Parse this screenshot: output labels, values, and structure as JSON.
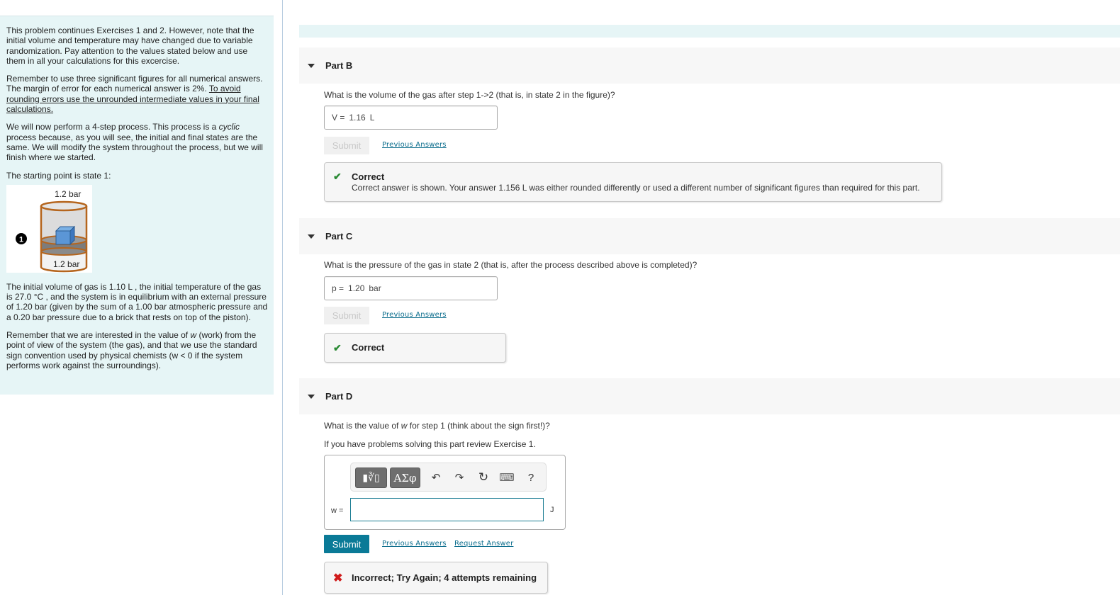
{
  "intro": {
    "p1": "This problem continues Exercises 1 and 2. However, note that the initial volume and temperature may have changed due to variable randomization. Pay attention to the values stated below and use them in all your calculations for this excercise.",
    "p2_plain": "Remember to use three significant figures for all numerical answers. The margin of error for each numerical answer is 2%. ",
    "p2_underlined": "To avoid rounding errors use the unrounded intermediate values in your final calculations.",
    "p3_before": "We will now perform a 4-step process. This process is a ",
    "p3_italic": "cyclic",
    "p3_after": " process because, as you will see, the initial and final states are the same. We will modify the system throughout the process, but we will finish where we started.",
    "p4": "The starting point is state 1:",
    "figure": {
      "state_number": "1",
      "top_pressure": "1.2 bar",
      "gas_pressure": "1.2 bar"
    },
    "p5": "The initial volume of gas is  1.10 L , the initial temperature of the gas is  27.0 °C , and the system is in equilibrium with an external pressure of 1.20 bar (given by the sum of a 1.00 bar atmospheric pressure and a 0.20 bar pressure due to a brick that rests on top of the piston).",
    "p6_before": "Remember that we are interested in the value of ",
    "p6_italic": "w",
    "p6_after": " (work) from the point of view of the system (the gas), and that we use the standard sign convention used by physical chemists (w < 0 if the system performs work against the surroundings)."
  },
  "partB": {
    "title": "Part B",
    "question": "What is the volume of the gas after step 1->2 (that is, in state 2 in the figure)?",
    "var": "V =",
    "value": "1.16",
    "unit": "L",
    "submit": "Submit",
    "previous_answers": "Previous Answers",
    "feedback_title": "Correct",
    "feedback_text": "Correct answer is shown. Your answer 1.156 L was either rounded differently or used a different number of significant figures than required for this part."
  },
  "partC": {
    "title": "Part C",
    "question": "What is the pressure of the gas in state 2 (that is, after the process described above is completed)?",
    "var": "p =",
    "value": "1.20",
    "unit": "bar",
    "submit": "Submit",
    "previous_answers": "Previous Answers",
    "feedback_title": "Correct"
  },
  "partD": {
    "title": "Part D",
    "question_before": "What is the value of ",
    "question_italic": "w",
    "question_after": " for step 1 (think about the sign first!)?",
    "hint": "If you have problems solving this part review Exercise 1.",
    "toolbar": {
      "templates": "▮∛▯",
      "symbols": "ΑΣφ",
      "undo": "↶",
      "redo": "↷",
      "reset": "↻",
      "keyboard": "⌨",
      "help": "?"
    },
    "var": "w =",
    "value": "",
    "unit": "J",
    "submit": "Submit",
    "previous_answers": "Previous Answers",
    "request_answer": "Request Answer",
    "feedback_title": "Incorrect; Try Again; 4 attempts remaining"
  },
  "colors": {
    "intro_bg": "#e6f5f6",
    "submit_active": "#0a7a97",
    "link": "#0a6c8c",
    "correct": "#2a8a34",
    "incorrect": "#d01b1b"
  }
}
